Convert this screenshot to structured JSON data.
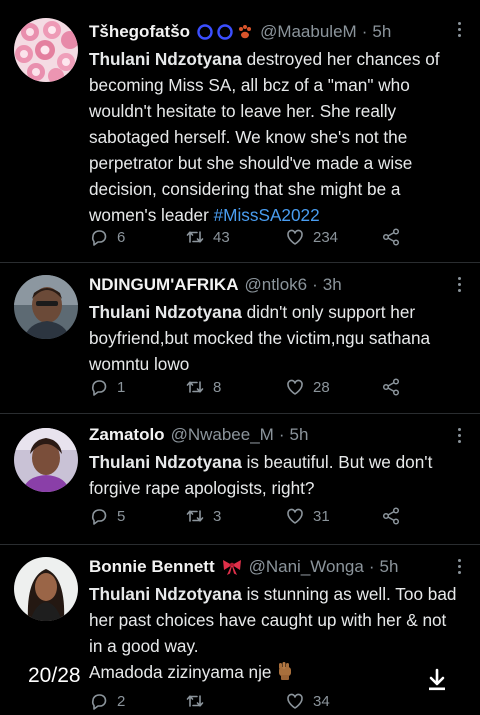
{
  "tweets": [
    {
      "name": "Tšhegofatšo",
      "badges": [
        "blue-circle",
        "blue-circle",
        "paw"
      ],
      "handle": "@MaabuleM",
      "time": "5h",
      "mention": "Thulani Ndzotyana",
      "text": " destroyed her chances of becoming Miss SA, all bcz of a \"man\" who wouldn't hesitate to leave her. She really sabotaged herself. We know she's not the perpetrator but she should've made a wise decision, considering that she might be a women's leader ",
      "hashtag": "#MissSA2022",
      "replies": "6",
      "retweets": "43",
      "likes": "234"
    },
    {
      "name": "NDINGUM'AFRIKA",
      "handle": "@ntlok6",
      "time": "3h",
      "mention": "Thulani Ndzotyana",
      "text": " didn't only support her boyfriend,but mocked the victim,ngu sathana womntu lowo",
      "replies": "1",
      "retweets": "8",
      "likes": "28"
    },
    {
      "name": "Zamatolo",
      "handle": "@Nwabee_M",
      "time": "5h",
      "mention": "Thulani Ndzotyana",
      "text": " is beautiful.  But we don't forgive rape apologists, right?",
      "replies": "5",
      "retweets": "3",
      "likes": "31"
    },
    {
      "name": "Bonnie Bennett",
      "badges": [
        "ribbon"
      ],
      "handle": "@Nani_Wonga",
      "time": "5h",
      "mention": "Thulani Ndzotyana",
      "text": " is stunning as well. Too bad her past choices have caught up with her & not in a good way.",
      "text2": "Amadoda zizinyama nje",
      "replies": "2",
      "retweets": "",
      "likes": "34"
    }
  ],
  "viewer": {
    "page_counter": "20/28"
  },
  "colors": {
    "background": "#000000",
    "hashtag": "#4a9df0",
    "muted": "#8b949b"
  }
}
